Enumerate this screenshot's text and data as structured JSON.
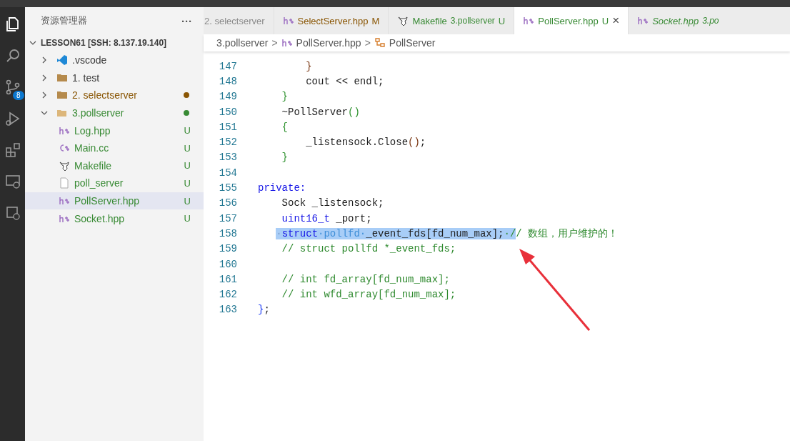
{
  "activity_bar": {
    "source_control_badge": "8"
  },
  "explorer": {
    "title": "资源管理器",
    "more": "···",
    "root": {
      "label": "LESSON61 [SSH: 8.137.19.140]",
      "expanded": true,
      "children": [
        {
          "label": ".vscode",
          "kind": "vscode",
          "expanded": false,
          "selected": false,
          "dot": false
        },
        {
          "label": "1. test",
          "kind": "folder",
          "expanded": false,
          "selected": false,
          "dot": false
        },
        {
          "label": "2. selectserver",
          "kind": "folder",
          "expanded": false,
          "selected": false,
          "dot": true,
          "color": "#895503"
        },
        {
          "label": "3.pollserver",
          "kind": "folder",
          "expanded": true,
          "selected": false,
          "dot": true,
          "color": "#388a34",
          "children": [
            {
              "label": "Log.hpp",
              "kind": "hpp",
              "selected": false,
              "color": "#388a34",
              "badge": "U"
            },
            {
              "label": "Main.cc",
              "kind": "cc",
              "selected": false,
              "color": "#388a34",
              "badge": "U"
            },
            {
              "label": "Makefile",
              "kind": "makefile",
              "selected": false,
              "color": "#388a34",
              "badge": "U"
            },
            {
              "label": "poll_server",
              "kind": "file",
              "selected": false,
              "color": "#388a34",
              "badge": "U"
            },
            {
              "label": "PollServer.hpp",
              "kind": "hpp",
              "selected": true,
              "color": "#388a34",
              "badge": "U"
            },
            {
              "label": "Socket.hpp",
              "kind": "hpp",
              "selected": false,
              "color": "#388a34",
              "badge": "U"
            }
          ]
        }
      ]
    }
  },
  "tabs": [
    {
      "label": "2. selectserver",
      "kind": "plain",
      "selected": false
    },
    {
      "label": "SelectServer.hpp",
      "kind": "hpp",
      "badge": "M",
      "color": "#895503",
      "selected": false
    },
    {
      "label": "Makefile",
      "kind": "makefile",
      "description": "3.pollserver",
      "badge": "U",
      "color": "#388a34",
      "selected": false
    },
    {
      "label": "PollServer.hpp",
      "kind": "hpp",
      "badge": "U",
      "color": "#388a34",
      "selected": true,
      "close": "×"
    },
    {
      "label": "Socket.hpp",
      "kind": "hpp",
      "description": "3.po",
      "color": "#388a34",
      "selected": false,
      "italic": true
    }
  ],
  "breadcrumb": [
    {
      "label": "3.pollserver",
      "kind": "folder"
    },
    {
      "label": "PollServer.hpp",
      "kind": "hpp"
    },
    {
      "label": "PollServer",
      "kind": "class"
    }
  ],
  "breadcrumb_separator": ">",
  "code_lines": [
    {
      "number": "147",
      "tokens": [
        {
          "kind": "brace3",
          "text": "        }",
          "selected": false
        }
      ]
    },
    {
      "number": "148",
      "tokens": [
        {
          "kind": "plain",
          "text": "        cout << endl;",
          "selected": false
        }
      ]
    },
    {
      "number": "149",
      "tokens": [
        {
          "kind": "brace2",
          "text": "    }",
          "selected": false
        }
      ]
    },
    {
      "number": "150",
      "tokens": [
        {
          "kind": "plain",
          "text": "    ~PollServer",
          "selected": false
        },
        {
          "kind": "brace2",
          "text": "()",
          "selected": false
        }
      ]
    },
    {
      "number": "151",
      "tokens": [
        {
          "kind": "brace2",
          "text": "    {",
          "selected": false
        }
      ]
    },
    {
      "number": "152",
      "tokens": [
        {
          "kind": "plain",
          "text": "        _listensock.Close",
          "selected": false
        },
        {
          "kind": "brace3",
          "text": "()",
          "selected": false
        },
        {
          "kind": "plain",
          "text": ";",
          "selected": false
        }
      ]
    },
    {
      "number": "153",
      "tokens": [
        {
          "kind": "brace2",
          "text": "    }",
          "selected": false
        }
      ]
    },
    {
      "number": "154"
    },
    {
      "number": "155",
      "tokens": [
        {
          "kind": "keyword",
          "text": "private:",
          "selected": false
        }
      ]
    },
    {
      "number": "156",
      "tokens": [
        {
          "kind": "plain",
          "text": "    Sock _listensock;",
          "selected": false
        }
      ]
    },
    {
      "number": "157",
      "tokens": [
        {
          "kind": "keyword",
          "text": "    uint16_t",
          "selected": false
        },
        {
          "kind": "plain",
          "text": " _port;",
          "selected": false
        }
      ]
    },
    {
      "number": "158",
      "tokens": [
        {
          "kind": "whitespace",
          "text": "   ·",
          "selected": true
        },
        {
          "kind": "keyword",
          "text": "struct",
          "selected": true
        },
        {
          "kind": "type",
          "text": "·pollfd·",
          "selected": true
        },
        {
          "kind": "plain",
          "text": "_event_fds[fd_num_max];",
          "selected": true
        },
        {
          "kind": "comment",
          "text": "·/",
          "selected": true
        },
        {
          "kind": "comment",
          "text": "/ 数组，用户维护的！",
          "selected": false
        }
      ]
    },
    {
      "number": "159",
      "tokens": [
        {
          "kind": "comment",
          "text": "    // struct pollfd *_event_fds;",
          "selected": false
        }
      ]
    },
    {
      "number": "160"
    },
    {
      "number": "161",
      "tokens": [
        {
          "kind": "comment",
          "text": "    // int fd_array[fd_num_max];",
          "selected": false
        }
      ]
    },
    {
      "number": "162",
      "tokens": [
        {
          "kind": "comment",
          "text": "    // int wfd_array[fd_num_max];",
          "selected": false
        }
      ]
    },
    {
      "number": "163",
      "tokens": [
        {
          "kind": "brace1",
          "text": "}",
          "selected": false
        },
        {
          "kind": "plain",
          "text": ";",
          "selected": false
        }
      ]
    }
  ]
}
